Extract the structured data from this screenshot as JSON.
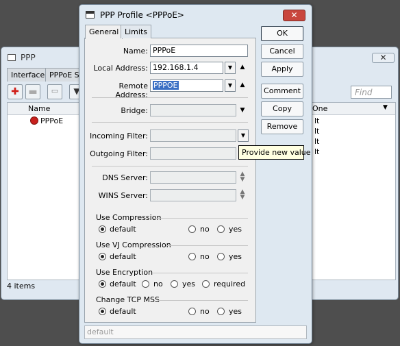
{
  "background_window": {
    "title": "PPP",
    "close_label": "✕",
    "tabs": [
      "Interface",
      "PPPoE Se"
    ],
    "find_placeholder": "Find",
    "columns": {
      "name": "Name",
      "one": "One"
    },
    "rows": [
      {
        "name": "PPPoE",
        "tail": "lt"
      },
      {
        "name": "",
        "tail": "lt"
      },
      {
        "name": "",
        "tail": "lt"
      },
      {
        "name": "",
        "tail": "lt"
      }
    ],
    "status": "4 items"
  },
  "dialog": {
    "title": "PPP Profile <PPPoE>",
    "close_label": "✕",
    "tabs": {
      "general": "General",
      "limits": "Limits"
    },
    "fields": {
      "name": {
        "label": "Name:",
        "value": "PPPoE"
      },
      "local_address": {
        "label": "Local Address:",
        "value": "192.168.1.4"
      },
      "remote_address": {
        "label": "Remote Address:",
        "value": "PPPOE"
      },
      "bridge": {
        "label": "Bridge:",
        "value": ""
      },
      "incoming_filter": {
        "label": "Incoming Filter:",
        "value": ""
      },
      "outgoing_filter": {
        "label": "Outgoing Filter:",
        "value": ""
      },
      "dns_server": {
        "label": "DNS Server:",
        "value": ""
      },
      "wins_server": {
        "label": "WINS Server:",
        "value": ""
      }
    },
    "groups": {
      "use_compression": {
        "title": "Use Compression",
        "options": [
          "default",
          "no",
          "yes"
        ],
        "selected": "default"
      },
      "use_vj_compression": {
        "title": "Use VJ Compression",
        "options": [
          "default",
          "no",
          "yes"
        ],
        "selected": "default"
      },
      "use_encryption": {
        "title": "Use Encryption",
        "options": [
          "default",
          "no",
          "yes",
          "required"
        ],
        "selected": "default"
      },
      "change_tcp_mss": {
        "title": "Change TCP MSS",
        "options": [
          "default",
          "no",
          "yes"
        ],
        "selected": "default"
      }
    },
    "buttons": {
      "ok": "OK",
      "cancel": "Cancel",
      "apply": "Apply",
      "comment": "Comment",
      "copy": "Copy",
      "remove": "Remove"
    },
    "status": "default",
    "tooltip": "Provide new value"
  }
}
